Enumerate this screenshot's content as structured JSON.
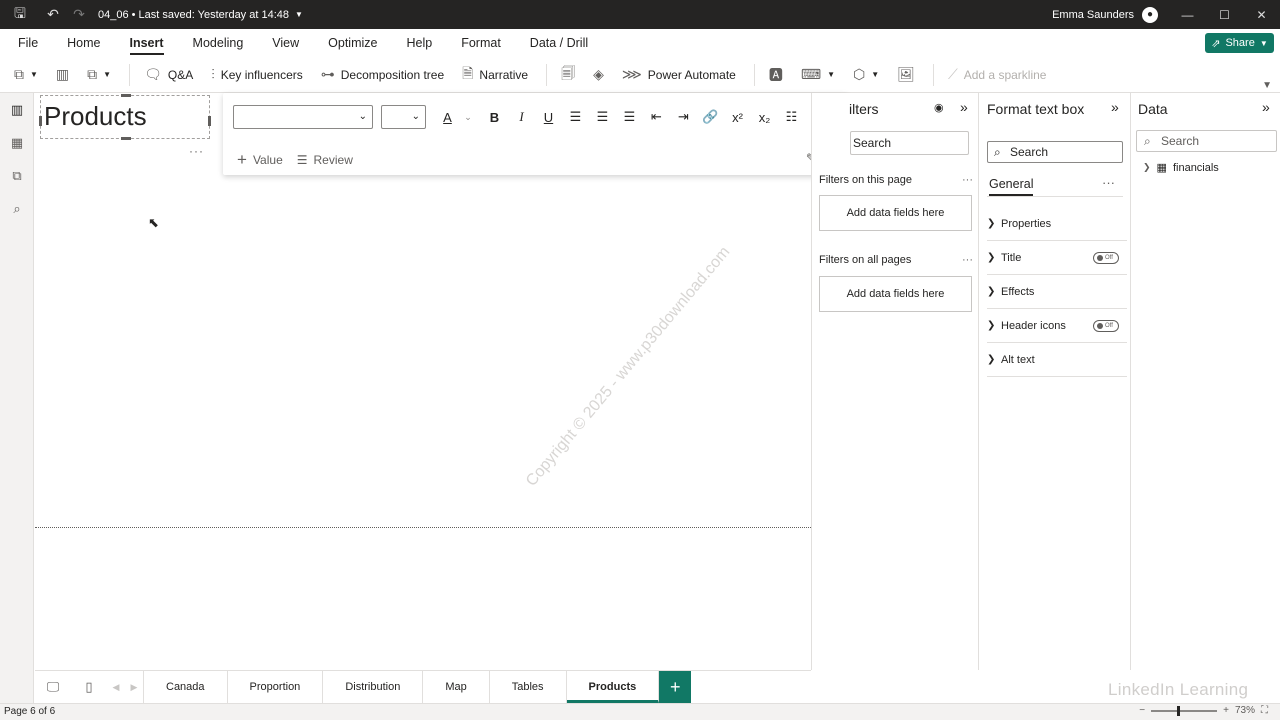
{
  "titlebar": {
    "title": "04_06 • Last saved: Yesterday at 14:48",
    "user": "Emma Saunders",
    "minimize": "—",
    "maximize": "☐",
    "close": "✕"
  },
  "menu": {
    "tabs": [
      "File",
      "Home",
      "Insert",
      "Modeling",
      "View",
      "Optimize",
      "Help",
      "Format",
      "Data / Drill"
    ],
    "active": "Insert",
    "share": "Share"
  },
  "ribbon": {
    "qa": "Q&A",
    "key_influencers": "Key influencers",
    "decomposition_tree": "Decomposition tree",
    "narrative": "Narrative",
    "power_automate": "Power Automate",
    "add_sparkline": "Add a sparkline"
  },
  "canvas": {
    "textbox_text": "Products",
    "watermark": "Copyright © 2025 - www.p30download.com"
  },
  "format_toolbar": {
    "value_label": "Value",
    "review_label": "Review"
  },
  "filters_pane": {
    "title": "ilters",
    "search_placeholder": "Search",
    "on_this_page": "Filters on this page",
    "on_all_pages": "Filters on all pages",
    "add_fields": "Add data fields here"
  },
  "format_pane": {
    "title": "Format text box",
    "search_placeholder": "Search",
    "general_tab": "General",
    "rows": [
      {
        "label": "Properties",
        "toggle": null
      },
      {
        "label": "Title",
        "toggle": "Off"
      },
      {
        "label": "Effects",
        "toggle": null
      },
      {
        "label": "Header icons",
        "toggle": "Off"
      },
      {
        "label": "Alt text",
        "toggle": null
      }
    ]
  },
  "data_pane": {
    "title": "Data",
    "search_placeholder": "Search",
    "tables": [
      "financials"
    ]
  },
  "pages": {
    "tabs": [
      "Canada",
      "Proportion",
      "Distribution",
      "Map",
      "Tables",
      "Products"
    ],
    "active": "Products",
    "add": "+"
  },
  "status": {
    "page_info": "Page 6 of 6",
    "zoom": "73%",
    "brand_watermark": "LinkedIn Learning"
  },
  "colors": {
    "accent": "#117865",
    "titlebar": "#252423"
  }
}
